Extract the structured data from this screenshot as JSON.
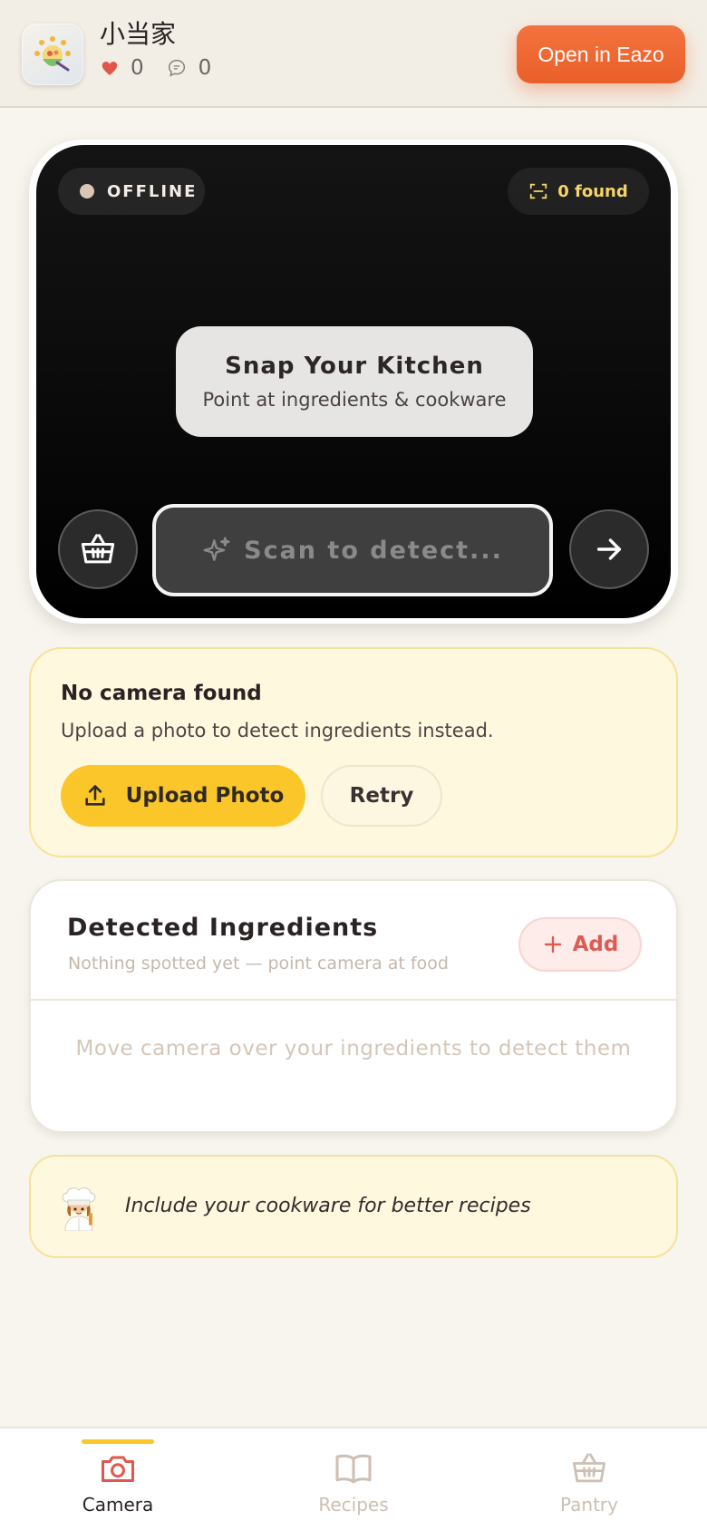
{
  "header": {
    "app_name": "小当家",
    "likes_count": "0",
    "comments_count": "0",
    "open_button_label": "Open in Eazo",
    "accent_color": "#ef6a35"
  },
  "camera": {
    "status_label": "OFFLINE",
    "found_label": "0 found",
    "prompt_title": "Snap Your Kitchen",
    "prompt_subtitle": "Point at ingredients & cookware",
    "scan_button_label": "Scan to detect...",
    "left_button_icon": "basket-icon",
    "right_button_icon": "arrow-right-icon"
  },
  "no_camera": {
    "title": "No camera found",
    "message": "Upload a photo to detect ingredients instead.",
    "upload_label": "Upload Photo",
    "retry_label": "Retry",
    "upload_color": "#fbc62a"
  },
  "detected": {
    "title": "Detected Ingredients",
    "subtitle": "Nothing spotted yet — point camera at food",
    "add_label": "Add",
    "empty_message": "Move camera over your ingredients to detect them"
  },
  "tip": {
    "emoji": "👩‍🍳",
    "text": "Include your cookware for better recipes"
  },
  "bottom_nav": {
    "items": [
      {
        "label": "Camera",
        "icon": "camera-icon",
        "active": true
      },
      {
        "label": "Recipes",
        "icon": "book-icon",
        "active": false
      },
      {
        "label": "Pantry",
        "icon": "basket-icon",
        "active": false
      }
    ],
    "active_color": "#e2574c",
    "inactive_color": "#cdbfb2"
  }
}
